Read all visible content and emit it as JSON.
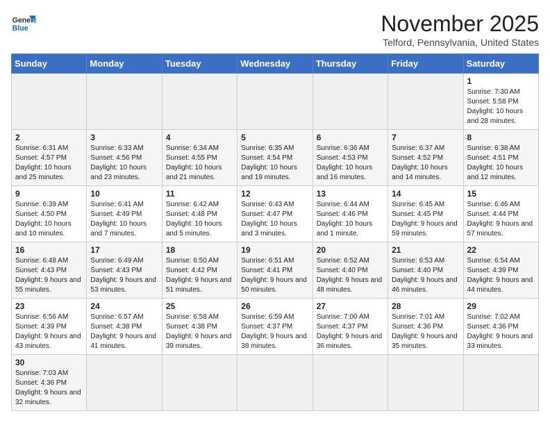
{
  "header": {
    "logo_general": "General",
    "logo_blue": "Blue",
    "month": "November 2025",
    "location": "Telford, Pennsylvania, United States"
  },
  "days_of_week": [
    "Sunday",
    "Monday",
    "Tuesday",
    "Wednesday",
    "Thursday",
    "Friday",
    "Saturday"
  ],
  "weeks": [
    [
      {
        "day": "",
        "info": ""
      },
      {
        "day": "",
        "info": ""
      },
      {
        "day": "",
        "info": ""
      },
      {
        "day": "",
        "info": ""
      },
      {
        "day": "",
        "info": ""
      },
      {
        "day": "",
        "info": ""
      },
      {
        "day": "1",
        "info": "Sunrise: 7:30 AM\nSunset: 5:58 PM\nDaylight: 10 hours and 28 minutes."
      }
    ],
    [
      {
        "day": "2",
        "info": "Sunrise: 6:31 AM\nSunset: 4:57 PM\nDaylight: 10 hours and 25 minutes."
      },
      {
        "day": "3",
        "info": "Sunrise: 6:33 AM\nSunset: 4:56 PM\nDaylight: 10 hours and 23 minutes."
      },
      {
        "day": "4",
        "info": "Sunrise: 6:34 AM\nSunset: 4:55 PM\nDaylight: 10 hours and 21 minutes."
      },
      {
        "day": "5",
        "info": "Sunrise: 6:35 AM\nSunset: 4:54 PM\nDaylight: 10 hours and 19 minutes."
      },
      {
        "day": "6",
        "info": "Sunrise: 6:36 AM\nSunset: 4:53 PM\nDaylight: 10 hours and 16 minutes."
      },
      {
        "day": "7",
        "info": "Sunrise: 6:37 AM\nSunset: 4:52 PM\nDaylight: 10 hours and 14 minutes."
      },
      {
        "day": "8",
        "info": "Sunrise: 6:38 AM\nSunset: 4:51 PM\nDaylight: 10 hours and 12 minutes."
      }
    ],
    [
      {
        "day": "9",
        "info": "Sunrise: 6:39 AM\nSunset: 4:50 PM\nDaylight: 10 hours and 10 minutes."
      },
      {
        "day": "10",
        "info": "Sunrise: 6:41 AM\nSunset: 4:49 PM\nDaylight: 10 hours and 7 minutes."
      },
      {
        "day": "11",
        "info": "Sunrise: 6:42 AM\nSunset: 4:48 PM\nDaylight: 10 hours and 5 minutes."
      },
      {
        "day": "12",
        "info": "Sunrise: 6:43 AM\nSunset: 4:47 PM\nDaylight: 10 hours and 3 minutes."
      },
      {
        "day": "13",
        "info": "Sunrise: 6:44 AM\nSunset: 4:46 PM\nDaylight: 10 hours and 1 minute."
      },
      {
        "day": "14",
        "info": "Sunrise: 6:45 AM\nSunset: 4:45 PM\nDaylight: 9 hours and 59 minutes."
      },
      {
        "day": "15",
        "info": "Sunrise: 6:46 AM\nSunset: 4:44 PM\nDaylight: 9 hours and 57 minutes."
      }
    ],
    [
      {
        "day": "16",
        "info": "Sunrise: 6:48 AM\nSunset: 4:43 PM\nDaylight: 9 hours and 55 minutes."
      },
      {
        "day": "17",
        "info": "Sunrise: 6:49 AM\nSunset: 4:43 PM\nDaylight: 9 hours and 53 minutes."
      },
      {
        "day": "18",
        "info": "Sunrise: 6:50 AM\nSunset: 4:42 PM\nDaylight: 9 hours and 51 minutes."
      },
      {
        "day": "19",
        "info": "Sunrise: 6:51 AM\nSunset: 4:41 PM\nDaylight: 9 hours and 50 minutes."
      },
      {
        "day": "20",
        "info": "Sunrise: 6:52 AM\nSunset: 4:40 PM\nDaylight: 9 hours and 48 minutes."
      },
      {
        "day": "21",
        "info": "Sunrise: 6:53 AM\nSunset: 4:40 PM\nDaylight: 9 hours and 46 minutes."
      },
      {
        "day": "22",
        "info": "Sunrise: 6:54 AM\nSunset: 4:39 PM\nDaylight: 9 hours and 44 minutes."
      }
    ],
    [
      {
        "day": "23",
        "info": "Sunrise: 6:56 AM\nSunset: 4:39 PM\nDaylight: 9 hours and 43 minutes."
      },
      {
        "day": "24",
        "info": "Sunrise: 6:57 AM\nSunset: 4:38 PM\nDaylight: 9 hours and 41 minutes."
      },
      {
        "day": "25",
        "info": "Sunrise: 6:58 AM\nSunset: 4:38 PM\nDaylight: 9 hours and 39 minutes."
      },
      {
        "day": "26",
        "info": "Sunrise: 6:59 AM\nSunset: 4:37 PM\nDaylight: 9 hours and 38 minutes."
      },
      {
        "day": "27",
        "info": "Sunrise: 7:00 AM\nSunset: 4:37 PM\nDaylight: 9 hours and 36 minutes."
      },
      {
        "day": "28",
        "info": "Sunrise: 7:01 AM\nSunset: 4:36 PM\nDaylight: 9 hours and 35 minutes."
      },
      {
        "day": "29",
        "info": "Sunrise: 7:02 AM\nSunset: 4:36 PM\nDaylight: 9 hours and 33 minutes."
      }
    ],
    [
      {
        "day": "30",
        "info": "Sunrise: 7:03 AM\nSunset: 4:36 PM\nDaylight: 9 hours and 32 minutes."
      },
      {
        "day": "",
        "info": ""
      },
      {
        "day": "",
        "info": ""
      },
      {
        "day": "",
        "info": ""
      },
      {
        "day": "",
        "info": ""
      },
      {
        "day": "",
        "info": ""
      },
      {
        "day": "",
        "info": ""
      }
    ]
  ]
}
